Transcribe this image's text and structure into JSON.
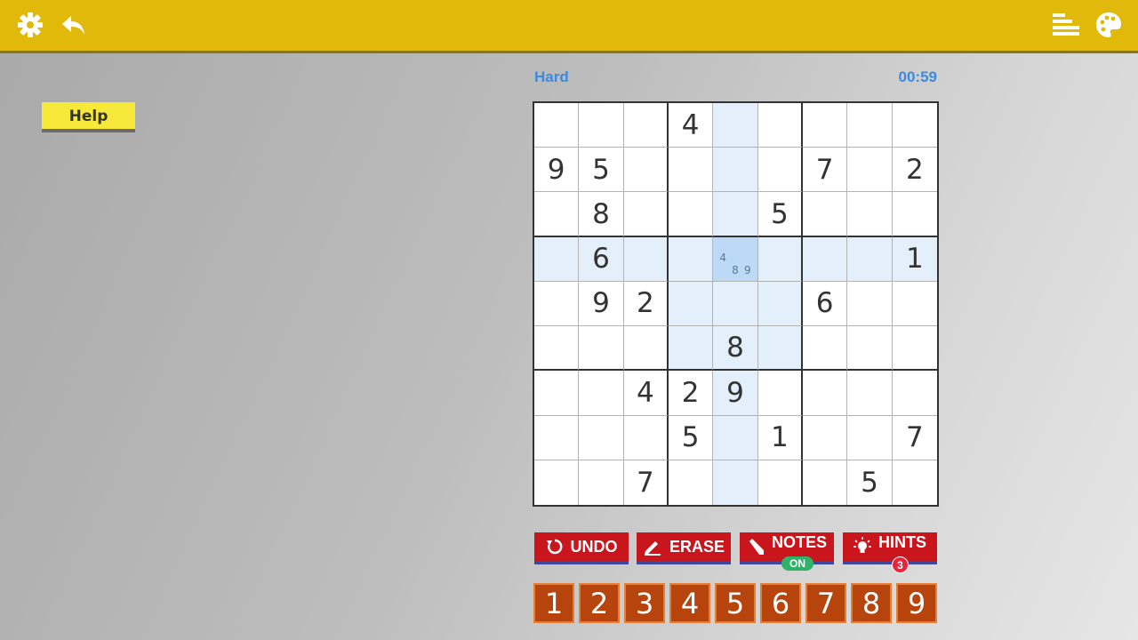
{
  "topbar": {
    "icons": [
      "gear-icon",
      "back-arrow-icon",
      "menu-bars-icon",
      "palette-icon"
    ],
    "color": "#e0b90a"
  },
  "help": {
    "label": "Help"
  },
  "game": {
    "difficulty": "Hard",
    "timer": "00:59",
    "selected": {
      "row": 3,
      "col": 4
    },
    "board": [
      [
        "",
        "",
        "",
        "4",
        "",
        "",
        "",
        "",
        ""
      ],
      [
        "9",
        "5",
        "",
        "",
        "",
        "",
        "7",
        "",
        "2"
      ],
      [
        "",
        "8",
        "",
        "",
        "",
        "5",
        "",
        "",
        ""
      ],
      [
        "",
        "6",
        "",
        "",
        "",
        "",
        "",
        "",
        "1"
      ],
      [
        "",
        "9",
        "2",
        "",
        "",
        "",
        "6",
        "",
        ""
      ],
      [
        "",
        "",
        "",
        "",
        "8",
        "",
        "",
        "",
        ""
      ],
      [
        "",
        "",
        "4",
        "2",
        "9",
        "",
        "",
        "",
        ""
      ],
      [
        "",
        "",
        "",
        "5",
        "",
        "1",
        "",
        "",
        "7"
      ],
      [
        "",
        "",
        "7",
        "",
        "",
        "",
        "",
        "5",
        ""
      ]
    ],
    "notes": {
      "3-4": [
        "4",
        "8",
        "9"
      ]
    }
  },
  "actions": {
    "undo": "UNDO",
    "erase": "ERASE",
    "notes": "NOTES",
    "notes_state": "ON",
    "hints": "HINTS",
    "hints_count": "3"
  },
  "numpad": [
    "1",
    "2",
    "3",
    "4",
    "5",
    "6",
    "7",
    "8",
    "9"
  ],
  "colors": {
    "accent": "#3b8be0",
    "action_red": "#c9161d",
    "numpad_orange": "#b6440c",
    "highlight": "#e3effb",
    "selected": "#bcd9f5"
  }
}
